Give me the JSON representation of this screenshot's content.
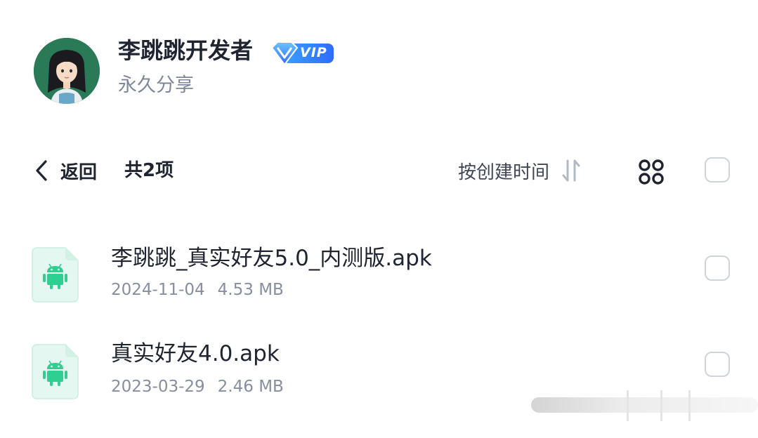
{
  "header": {
    "owner_name": "李跳跳开发者",
    "vip_label": "VIP",
    "share_type": "永久分享"
  },
  "toolbar": {
    "back_label": "返回",
    "count_label": "共2项",
    "sort_label": "按创建时间"
  },
  "files": [
    {
      "name": "李跳跳_真实好友5.0_内测版.apk",
      "date": "2024-11-04",
      "size": "4.53 MB",
      "icon": "android-apk-icon"
    },
    {
      "name": "真实好友4.0.apk",
      "date": "2023-03-29",
      "size": "2.46 MB",
      "icon": "android-apk-icon"
    }
  ],
  "colors": {
    "text_primary": "#1f2430",
    "text_secondary": "#7e8699",
    "vip_gradient_start": "#3aa0ff",
    "vip_gradient_end": "#2f6bff",
    "apk_icon_bg": "#e4f8f1",
    "apk_icon_fg": "#2fce91",
    "avatar_bg": "#2a7a58"
  }
}
